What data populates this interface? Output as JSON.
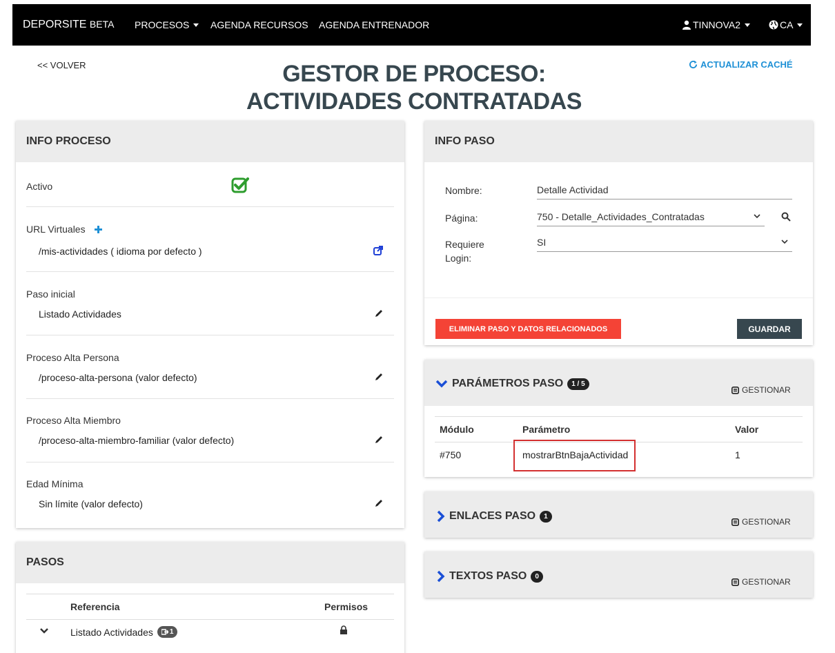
{
  "nav": {
    "brand": "DEPORSITE",
    "brand_suffix": "BETA",
    "procesos": "PROCESOS",
    "agenda_recursos": "AGENDA RECURSOS",
    "agenda_entrenador": "AGENDA ENTRENADOR",
    "user": "TINNOVA2",
    "lang": "CA"
  },
  "header": {
    "back": "<< VOLVER",
    "title": "GESTOR DE PROCESO: ACTIVIDADES CONTRATADAS",
    "refresh": "ACTUALIZAR CACHÉ"
  },
  "info_proceso": {
    "title": "INFO PROCESO",
    "activo_label": "Activo",
    "url_label": "URL Virtuales",
    "url_value": "/mis-actividades ( idioma por defecto )",
    "paso_inicial_label": "Paso inicial",
    "paso_inicial_value": "Listado Actividades",
    "alta_persona_label": "Proceso Alta Persona",
    "alta_persona_value": "/proceso-alta-persona (valor defecto)",
    "alta_miembro_label": "Proceso Alta Miembro",
    "alta_miembro_value": "/proceso-alta-miembro-familiar (valor defecto)",
    "edad_label": "Edad Mínima",
    "edad_value": "Sin límite (valor defecto)"
  },
  "pasos": {
    "title": "PASOS",
    "col_ref": "Referencia",
    "col_perm": "Permisos",
    "row1_ref": "Listado Actividades",
    "row1_badge": "1"
  },
  "info_paso": {
    "title": "INFO PASO",
    "nombre_label": "Nombre:",
    "nombre_value": "Detalle Actividad",
    "pagina_label": "Página:",
    "pagina_value": "750 - Detalle_Actividades_Contratadas",
    "login_label": "Requiere Login:",
    "login_value": "SI",
    "btn_delete": "ELIMINAR PASO Y DATOS RELACIONADOS",
    "btn_save": "GUARDAR"
  },
  "parametros": {
    "title": "PARÁMETROS PASO",
    "badge": "1 / 5",
    "gestionar": "GESTIONAR",
    "col_modulo": "Módulo",
    "col_param": "Parámetro",
    "col_valor": "Valor",
    "row_modulo": "#750",
    "row_param": "mostrarBtnBajaActividad",
    "row_valor": "1"
  },
  "enlaces": {
    "title": "ENLACES PASO",
    "badge": "1",
    "gestionar": "GESTIONAR"
  },
  "textos": {
    "title": "TEXTOS PASO",
    "badge": "0",
    "gestionar": "GESTIONAR"
  },
  "colors": {
    "accent_blue": "#1e90d6",
    "check_green": "#2e9d2e",
    "danger": "#f44336",
    "dark": "#37474f"
  }
}
